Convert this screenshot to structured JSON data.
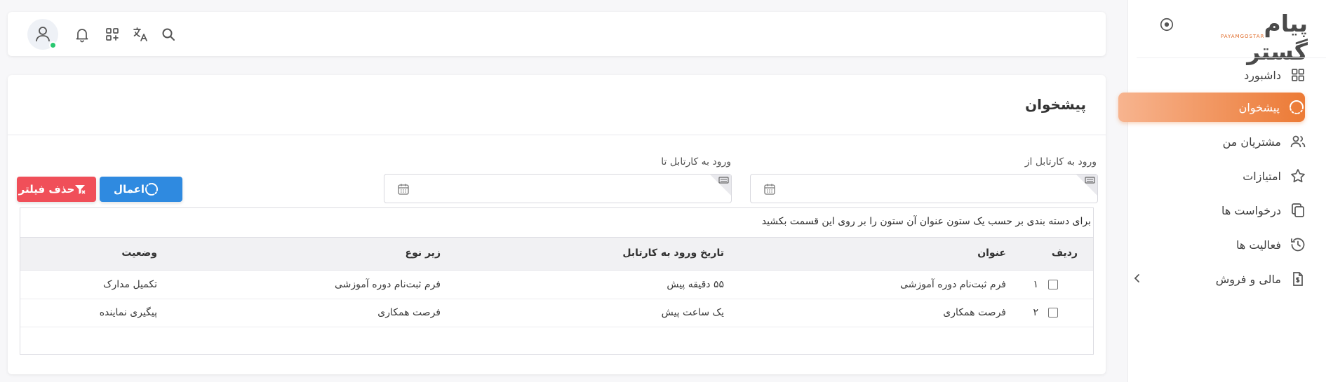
{
  "brand": {
    "name": "پیام گستر",
    "subtitle": "PAYAMGOSTAR"
  },
  "sidebar": {
    "items": [
      {
        "label": "داشبورد",
        "icon": "grid-icon"
      },
      {
        "label": "پیشخوان",
        "icon": "loader-icon",
        "active": true
      },
      {
        "label": "مشتریان من",
        "icon": "users-icon"
      },
      {
        "label": "امتیازات",
        "icon": "star-icon"
      },
      {
        "label": "درخواست ها",
        "icon": "copy-icon"
      },
      {
        "label": "فعالیت ها",
        "icon": "history-icon"
      },
      {
        "label": "مالی و فروش",
        "icon": "invoice-icon",
        "has_submenu": true
      }
    ],
    "accent": "#ec7a35"
  },
  "topbar": {
    "icons": [
      "search-icon",
      "translate-icon",
      "add-app-icon",
      "bell-icon",
      "user-avatar-icon"
    ],
    "online_color": "#28c76f"
  },
  "page": {
    "title": "پیشخوان",
    "filters": {
      "from_label": "ورود به کارتابل از",
      "to_label": "ورود به کارتابل تا",
      "from_value": "",
      "to_value": ""
    },
    "buttons": {
      "apply": "اعمال",
      "clear": "حذف فیلتر",
      "apply_color": "#2f8ae0",
      "clear_color": "#f04f59"
    },
    "grid": {
      "group_hint": "برای دسته بندی بر حسب یک ستون عنوان آن ستون را بر روی این قسمت بکشید",
      "columns": [
        "ردیف",
        "عنوان",
        "تاریخ ورود به کارتابل",
        "زیر نوع",
        "وضعیت"
      ],
      "rows": [
        {
          "index": "۱",
          "title": "فرم ثبت‌نام دوره آموزشی",
          "date": "۵۵ دقیقه پیش",
          "subtype": "فرم ثبت‌نام دوره آموزشی",
          "status": "تکمیل مدارک"
        },
        {
          "index": "۲",
          "title": "فرصت همکاری",
          "date": "یک ساعت پیش",
          "subtype": "فرصت همکاری",
          "status": "پیگیری نماینده"
        }
      ]
    }
  }
}
